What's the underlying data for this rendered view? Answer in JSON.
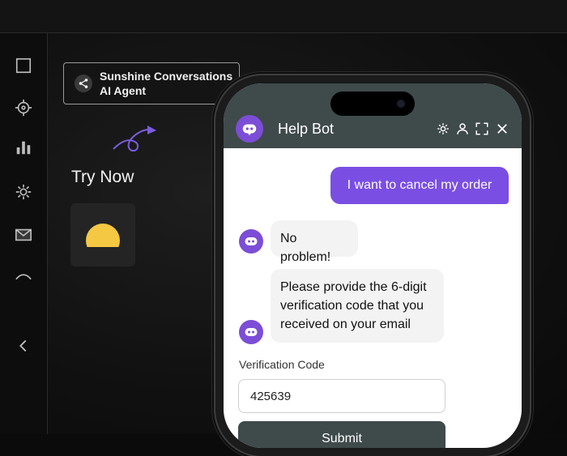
{
  "agent_chip": {
    "line1": "Sunshine Conversations",
    "line2": "AI Agent"
  },
  "cta": {
    "label": "Try Now"
  },
  "chat": {
    "title": "Help Bot",
    "messages": [
      {
        "from": "user",
        "text": "I want to cancel my order"
      },
      {
        "from": "bot",
        "text": "No problem!"
      },
      {
        "from": "bot",
        "text": "Please provide the 6-digit verification code that you received on your email"
      }
    ],
    "form": {
      "label": "Verification Code",
      "value": "425639",
      "submit_label": "Submit"
    }
  },
  "colors": {
    "accent": "#7a4ee3",
    "header": "#3f4a4b",
    "sun": "#f4c843"
  }
}
